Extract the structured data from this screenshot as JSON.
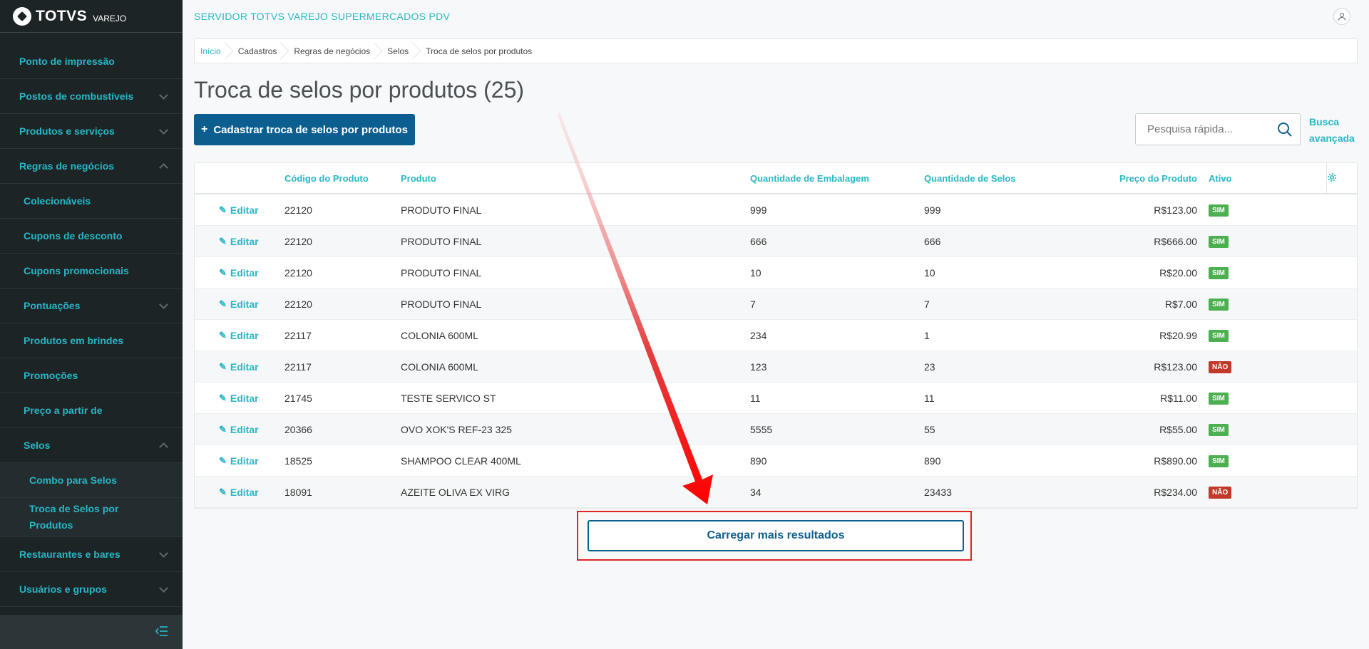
{
  "brand": {
    "name": "TOTVS",
    "sub": "VAREJO"
  },
  "sidebar": {
    "items": [
      {
        "label": "Ponto de impressão",
        "expand": "none"
      },
      {
        "label": "Postos de combustíveis",
        "expand": "down"
      },
      {
        "label": "Produtos e serviços",
        "expand": "down"
      },
      {
        "label": "Regras de negócios",
        "expand": "up"
      },
      {
        "label": "Colecionáveis",
        "expand": "none"
      },
      {
        "label": "Cupons de desconto",
        "expand": "none"
      },
      {
        "label": "Cupons promocionais",
        "expand": "none"
      },
      {
        "label": "Pontuações",
        "expand": "down"
      },
      {
        "label": "Produtos em brindes",
        "expand": "none"
      },
      {
        "label": "Promoções",
        "expand": "none"
      },
      {
        "label": "Preço a partir de",
        "expand": "none"
      },
      {
        "label": "Selos",
        "expand": "up"
      },
      {
        "label": "Combo para Selos",
        "expand": "none"
      },
      {
        "label": "Troca de Selos por Produtos",
        "expand": "none"
      },
      {
        "label": "Restaurantes e bares",
        "expand": "down"
      },
      {
        "label": "Usuários e grupos",
        "expand": "down"
      }
    ]
  },
  "header": {
    "server_title": "SERVIDOR TOTVS VAREJO SUPERMERCADOS PDV"
  },
  "breadcrumb": [
    "Início",
    "Cadastros",
    "Regras de negócios",
    "Selos",
    "Troca de selos por produtos"
  ],
  "page": {
    "title": "Troca de selos por produtos (25)",
    "add_label": "Cadastrar troca de selos por produtos",
    "search_placeholder": "Pesquisa rápida...",
    "advanced_search": "Busca avançada",
    "load_more": "Carregar mais resultados"
  },
  "table": {
    "headers": {
      "code": "Código do Produto",
      "product": "Produto",
      "pack_qty": "Quantidade de Embalagem",
      "stamp_qty": "Quantidade de Selos",
      "price": "Preço do Produto",
      "active": "Ativo"
    },
    "edit_label": "Editar",
    "rows": [
      {
        "code": "22120",
        "product": "PRODUTO FINAL",
        "pack_qty": "999",
        "stamp_qty": "999",
        "price": "R$123.00",
        "active": "SIM"
      },
      {
        "code": "22120",
        "product": "PRODUTO FINAL",
        "pack_qty": "666",
        "stamp_qty": "666",
        "price": "R$666.00",
        "active": "SIM"
      },
      {
        "code": "22120",
        "product": "PRODUTO FINAL",
        "pack_qty": "10",
        "stamp_qty": "10",
        "price": "R$20.00",
        "active": "SIM"
      },
      {
        "code": "22120",
        "product": "PRODUTO FINAL",
        "pack_qty": "7",
        "stamp_qty": "7",
        "price": "R$7.00",
        "active": "SIM"
      },
      {
        "code": "22117",
        "product": "COLONIA 600ML",
        "pack_qty": "234",
        "stamp_qty": "1",
        "price": "R$20.99",
        "active": "SIM"
      },
      {
        "code": "22117",
        "product": "COLONIA 600ML",
        "pack_qty": "123",
        "stamp_qty": "23",
        "price": "R$123.00",
        "active": "NÃO"
      },
      {
        "code": "21745",
        "product": "TESTE SERVICO ST",
        "pack_qty": "11",
        "stamp_qty": "11",
        "price": "R$11.00",
        "active": "SIM"
      },
      {
        "code": "20366",
        "product": "OVO XOK'S REF-23 325",
        "pack_qty": "5555",
        "stamp_qty": "55",
        "price": "R$55.00",
        "active": "SIM"
      },
      {
        "code": "18525",
        "product": "SHAMPOO CLEAR 400ML",
        "pack_qty": "890",
        "stamp_qty": "890",
        "price": "R$890.00",
        "active": "SIM"
      },
      {
        "code": "18091",
        "product": "AZEITE OLIVA EX VIRG",
        "pack_qty": "34",
        "stamp_qty": "23433",
        "price": "R$234.00",
        "active": "NÃO"
      }
    ]
  },
  "colors": {
    "accent": "#29b6c5",
    "primary": "#0c5e8f",
    "sidebar_bg": "#1d2426",
    "yes": "#4caf50",
    "no": "#c0392b",
    "highlight": "#e02525"
  }
}
